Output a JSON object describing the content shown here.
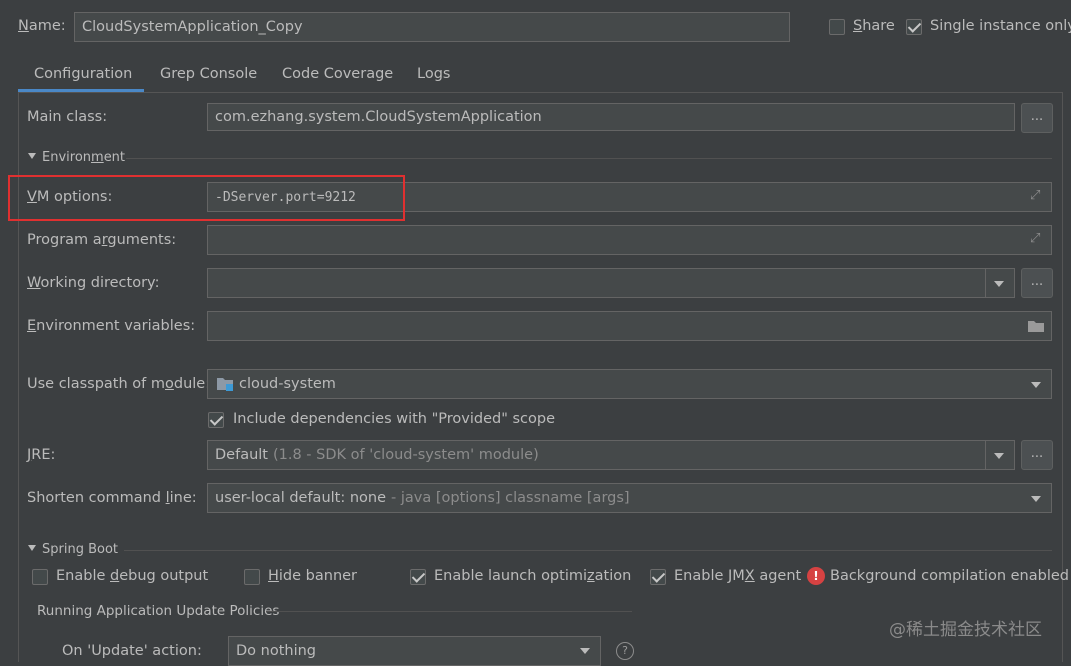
{
  "header": {
    "name_label": "Name:",
    "name_value": "CloudSystemApplication_Copy",
    "share_label": "Share",
    "share_checked": false,
    "single_instance_label": "Single instance only",
    "single_instance_checked": true
  },
  "tabs": [
    {
      "label": "Configuration",
      "active": true
    },
    {
      "label": "Grep Console",
      "active": false
    },
    {
      "label": "Code Coverage",
      "active": false
    },
    {
      "label": "Logs",
      "active": false
    }
  ],
  "config": {
    "main_class_label": "Main class:",
    "main_class_value": "com.ezhang.system.CloudSystemApplication",
    "browse_label": "...",
    "environment_section": "Environment",
    "vm_options_label": "VM options:",
    "vm_options_value": "-DServer.port=9212",
    "program_args_label": "Program arguments:",
    "program_args_value": "",
    "working_dir_label": "Working directory:",
    "working_dir_value": "",
    "env_vars_label": "Environment variables:",
    "env_vars_value": "",
    "classpath_label": "Use classpath of module:",
    "classpath_value": "cloud-system",
    "include_deps_label": "Include dependencies with \"Provided\" scope",
    "include_deps_checked": true,
    "jre_label": "JRE:",
    "jre_value_main": "Default",
    "jre_value_detail": "(1.8 - SDK of 'cloud-system' module)",
    "shorten_label": "Shorten command line:",
    "shorten_value_main": "user-local default: none",
    "shorten_value_detail": "- java [options] classname [args]"
  },
  "spring_boot": {
    "section": "Spring Boot",
    "debug_output_label": "Enable debug output",
    "debug_output_checked": false,
    "hide_banner_label": "Hide banner",
    "hide_banner_checked": false,
    "launch_opt_label": "Enable launch optimization",
    "launch_opt_checked": true,
    "jmx_label": "Enable JMX agent",
    "jmx_checked": true,
    "bg_compile_label": "Background compilation enabled",
    "policies_section": "Running Application Update Policies",
    "on_update_label": "On 'Update' action:",
    "on_update_value": "Do nothing",
    "help_label": "?"
  },
  "watermark": "@稀土掘金技术社区",
  "colors": {
    "background": "#3c3f41",
    "field": "#45494a",
    "highlight_box": "#e03030",
    "tab_underline": "#4a88c7",
    "warning": "#d64242"
  }
}
